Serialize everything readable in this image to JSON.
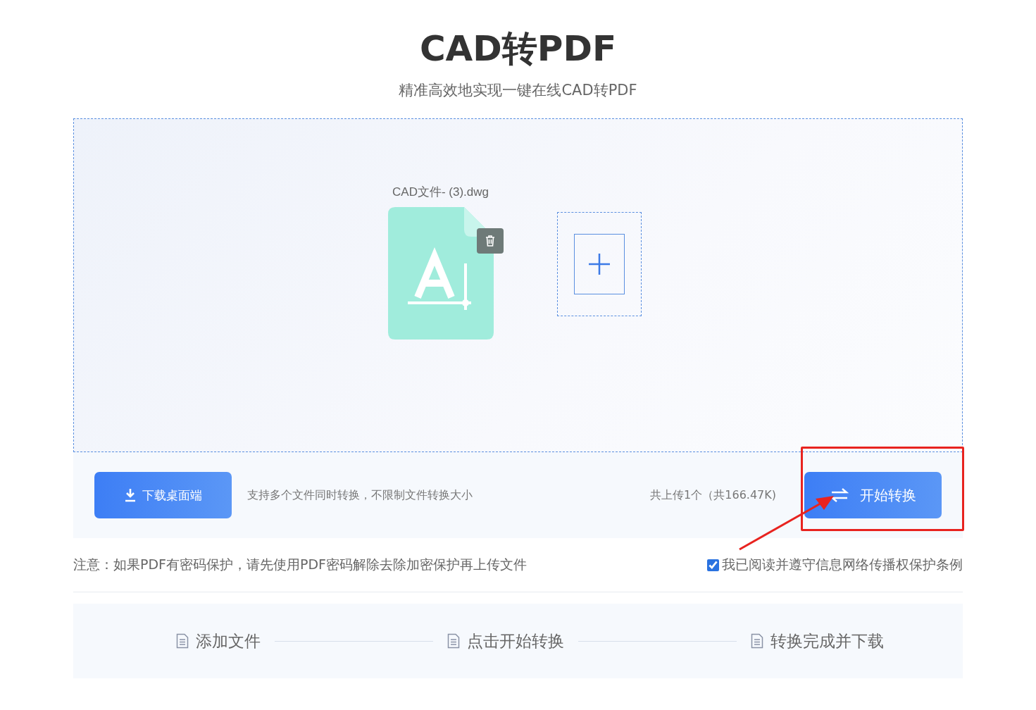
{
  "title": "CAD转PDF",
  "subtitle": "精准高效地实现一键在线CAD转PDF",
  "upload": {
    "files": [
      {
        "name": "CAD文件- (3).dwg"
      }
    ]
  },
  "toolbar": {
    "download_button": "下载桌面端",
    "support_text": "支持多个文件同时转换，不限制文件转换大小",
    "upload_count": "共上传1个（共166.47K)",
    "start_button": "开始转换"
  },
  "notice": "注意：如果PDF有密码保护，请先使用PDF密码解除去除加密保护再上传文件",
  "agreement": {
    "label": "我已阅读并遵守信息网络传播权保护条例",
    "checked": true
  },
  "steps": [
    {
      "label": "添加文件"
    },
    {
      "label": "点击开始转换"
    },
    {
      "label": "转换完成并下载"
    }
  ]
}
